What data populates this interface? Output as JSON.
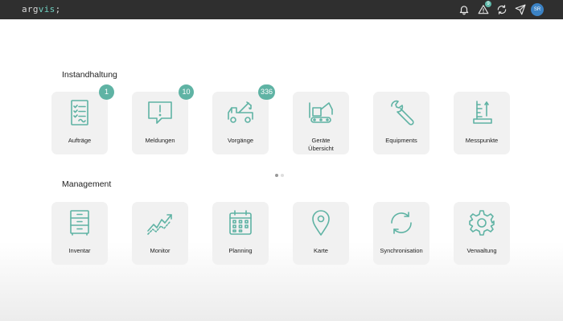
{
  "app": {
    "logo_prefix": "arg",
    "logo_accent": "vis",
    "logo_suffix": ";"
  },
  "topbar": {
    "alert_count": "9",
    "avatar_initials": "SR",
    "icons": [
      "bell-icon",
      "alert-icon",
      "sync-icon",
      "send-icon"
    ]
  },
  "sections": {
    "instandhaltung": {
      "title": "Instandhaltung",
      "tiles": [
        {
          "label": "Aufträge",
          "badge": "1",
          "icon": "clipboard-list-icon"
        },
        {
          "label": "Meldungen",
          "badge": "10",
          "icon": "message-alert-icon"
        },
        {
          "label": "Vorgänge",
          "badge": "336",
          "icon": "tow-truck-icon"
        },
        {
          "label_line1": "Geräte",
          "label_line2": "Übersicht",
          "icon": "crane-icon"
        },
        {
          "label": "Equipments",
          "icon": "wrench-icon"
        },
        {
          "label": "Messpunkte",
          "icon": "measuring-gauge-icon"
        }
      ]
    },
    "management": {
      "title": "Management",
      "tiles": [
        {
          "label": "Inventar",
          "icon": "cabinet-icon"
        },
        {
          "label": "Monitor",
          "icon": "trend-chart-icon"
        },
        {
          "label": "Planning",
          "icon": "calendar-icon"
        },
        {
          "label": "Karte",
          "icon": "map-pin-icon"
        },
        {
          "label": "Synchronisation",
          "icon": "sync-icon"
        },
        {
          "label": "Verwaltung",
          "icon": "gear-icon"
        }
      ]
    }
  },
  "carousel": {
    "pages": 2,
    "active": 1
  },
  "colors": {
    "topbar_bg": "#2f2f2f",
    "accent": "#5fb3a4",
    "tile_bg": "#f1f1f1",
    "avatar_bg": "#3b82c4"
  }
}
